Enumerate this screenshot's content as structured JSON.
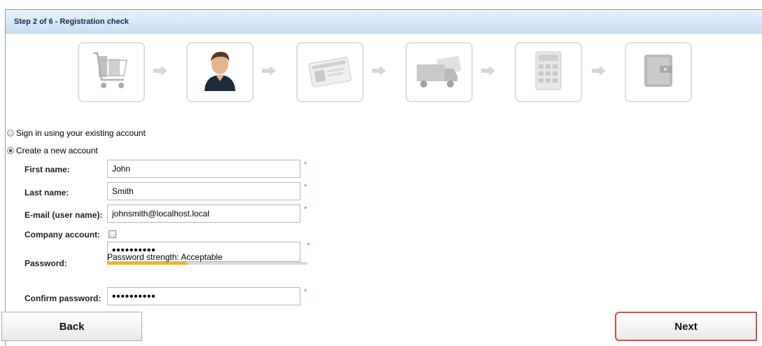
{
  "header": {
    "title": "Step 2 of 6 - Registration check"
  },
  "steps": [
    {
      "name": "cart",
      "active": false
    },
    {
      "name": "user",
      "active": true
    },
    {
      "name": "id-card",
      "active": false
    },
    {
      "name": "shipping-truck",
      "active": false
    },
    {
      "name": "calculator",
      "active": false
    },
    {
      "name": "wallet",
      "active": false
    }
  ],
  "options": {
    "sign_in": {
      "label": "Sign in using your existing account",
      "checked": false
    },
    "create": {
      "label": "Create a new account",
      "checked": true
    }
  },
  "form": {
    "first_name": {
      "label": "First name:",
      "value": "John"
    },
    "last_name": {
      "label": "Last name:",
      "value": "Smith"
    },
    "email": {
      "label": "E-mail (user name):",
      "value": "johnsmith@localhost.local"
    },
    "company": {
      "label": "Company account:",
      "checked": false
    },
    "password": {
      "label": "Password:",
      "value": "••••••••••"
    },
    "strength": {
      "text": "Password strength: Acceptable",
      "level": 0.4,
      "color": "#f2b418"
    },
    "confirm": {
      "label": "Confirm password:",
      "value": "••••••••••"
    },
    "required_mark": "*"
  },
  "buttons": {
    "back": "Back",
    "next": "Next"
  },
  "colors": {
    "header_text": "#0f2d4e",
    "required": "#e0602a",
    "highlight": "#d94a4a"
  }
}
